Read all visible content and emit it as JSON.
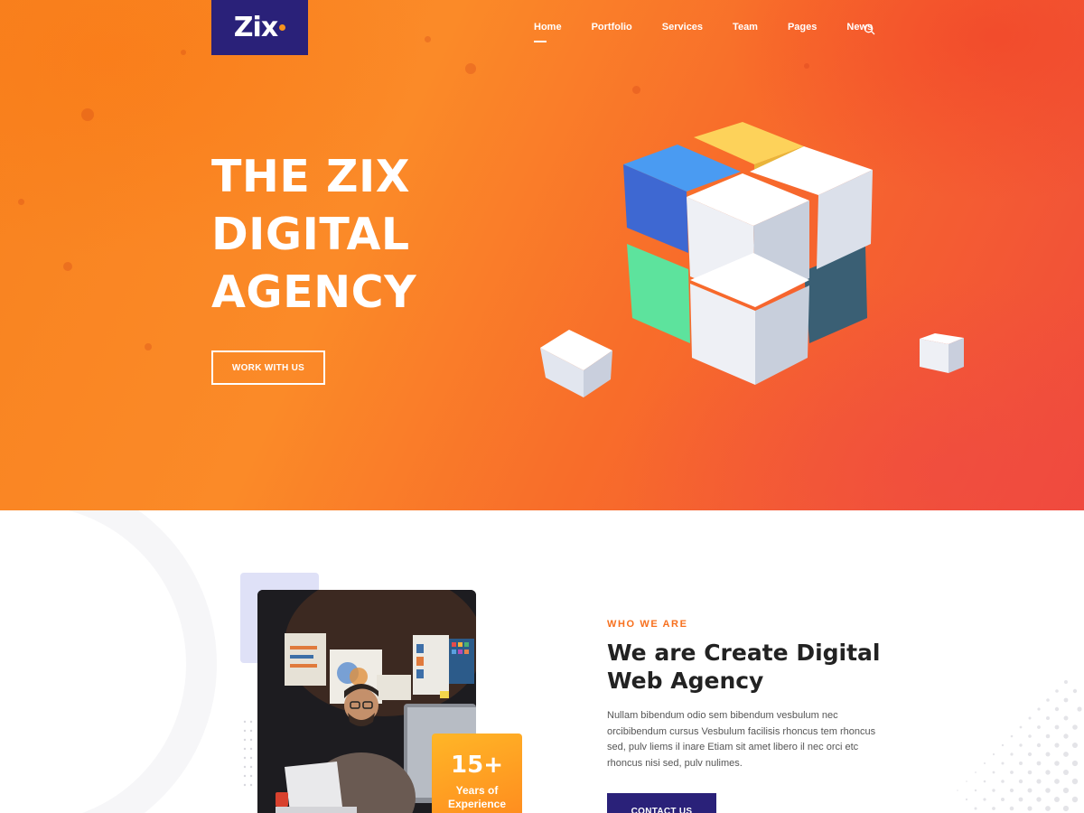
{
  "brand": {
    "logo_text": "Zix",
    "logo_color": "#2a2179",
    "accent": "#f7931e"
  },
  "nav": {
    "items": [
      {
        "label": "Home",
        "active": true
      },
      {
        "label": "Portfolio",
        "active": false
      },
      {
        "label": "Services",
        "active": false
      },
      {
        "label": "Team",
        "active": false
      },
      {
        "label": "Pages",
        "active": false
      },
      {
        "label": "News",
        "active": false
      }
    ],
    "search_icon": "search-icon"
  },
  "hero": {
    "title_lines": [
      "THE ZIX",
      "DIGITAL",
      "AGENCY"
    ],
    "button_label": "WORK WITH US",
    "illustration": "cube-illustration"
  },
  "about": {
    "eyebrow": "WHO WE ARE",
    "title": "We are Create Digital Web Agency",
    "body": "Nullam bibendum odio sem bibendum vesbulum nec orcibibendum cursus Vesbulum facilisis rhoncus tem rhoncus sed, pulv liems il inare Etiam sit amet libero il nec orci etc rhoncus nisi sed, pulv nulimes.",
    "button_label": "CONTACT US",
    "badge": {
      "number": "15+",
      "label_line1": "Years of",
      "label_line2": "Experience"
    },
    "photo": "man-at-desk-photo"
  },
  "colors": {
    "hero_orange": "#fb8a28",
    "hero_red": "#f04b3b",
    "navy": "#2a2179",
    "eyebrow_orange": "#f7701e",
    "badge_orange": "#ffa322"
  }
}
